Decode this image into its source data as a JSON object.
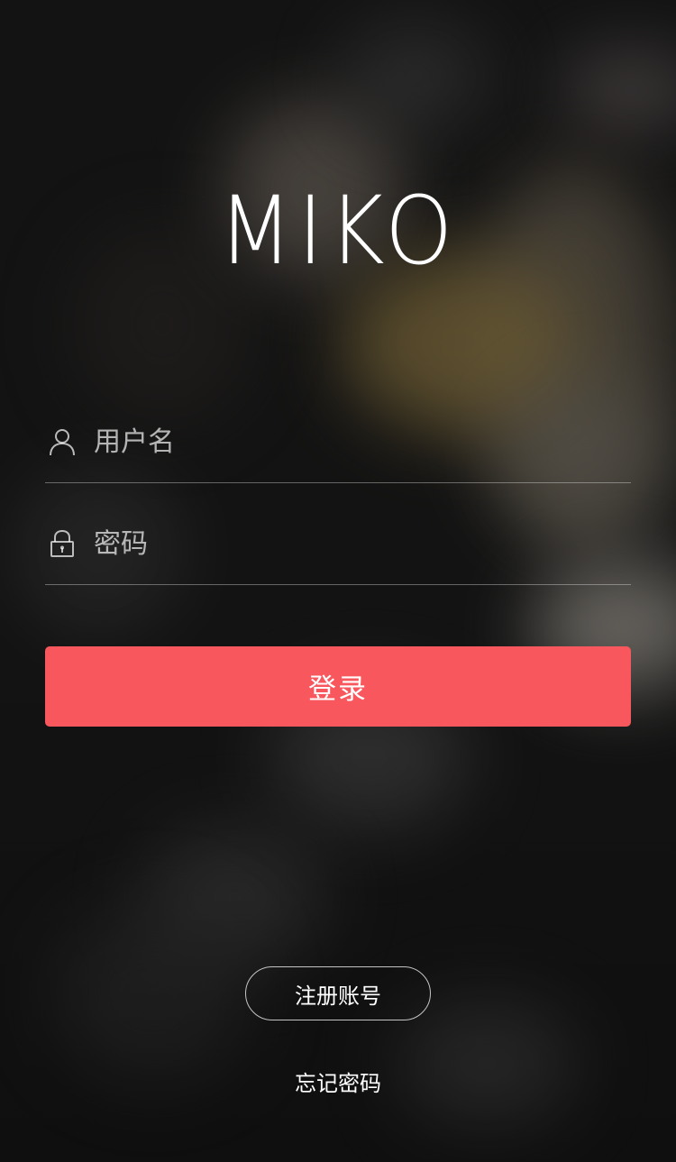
{
  "app": {
    "logo_text": "MIKO"
  },
  "form": {
    "username": {
      "icon": "user-icon",
      "placeholder": "用户名",
      "value": ""
    },
    "password": {
      "icon": "lock-icon",
      "placeholder": "密码",
      "value": ""
    },
    "login_label": "登录"
  },
  "footer": {
    "register_label": "注册账号",
    "forgot_label": "忘记密码"
  },
  "colors": {
    "accent": "#f8575d",
    "text": "#ffffff",
    "background": "#141414"
  }
}
